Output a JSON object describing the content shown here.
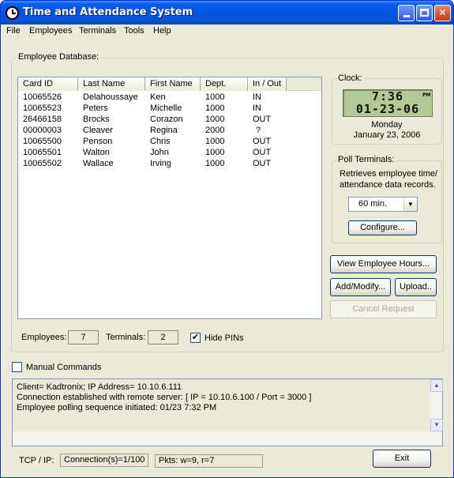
{
  "window": {
    "title": "Time and Attendance System"
  },
  "menu": [
    "File",
    "Employees",
    "Terminals",
    "Tools",
    "Help"
  ],
  "employee_db": {
    "group_label": "Employee Database:",
    "columns": [
      "Card ID",
      "Last Name",
      "First Name",
      "Dept.",
      "In / Out"
    ],
    "rows": [
      [
        "10065526",
        "Delahoussaye",
        "Ken",
        "1000",
        "IN"
      ],
      [
        "10065523",
        "Peters",
        "Michelle",
        "1000",
        "IN"
      ],
      [
        "26466158",
        "Brocks",
        "Corazon",
        "1000",
        "OUT"
      ],
      [
        "00000003",
        "Cleaver",
        "Regina",
        "2000",
        "?"
      ],
      [
        "10065500",
        "Penson",
        "Chris",
        "1000",
        "OUT"
      ],
      [
        "10065501",
        "Walton",
        "John",
        "1000",
        "OUT"
      ],
      [
        "10065502",
        "Wallace",
        "Irving",
        "1000",
        "OUT"
      ]
    ],
    "employees_label": "Employees:",
    "employees_count": "7",
    "terminals_label": "Terminals:",
    "terminals_count": "2",
    "hide_pins_label": "Hide PINs",
    "hide_pins_checked": true
  },
  "clock": {
    "group_label": "Clock:",
    "time": "7:36",
    "ampm": "PM",
    "date": "01-23-06",
    "weekday": "Monday",
    "long_date": "January 23, 2006"
  },
  "poll": {
    "group_label": "Poll Terminals:",
    "description_line1": "Retrieves employee time/",
    "description_line2": "attendance data records.",
    "interval": "60 min.",
    "configure_label": "Configure..."
  },
  "actions": {
    "view_hours": "View Employee Hours...",
    "add_modify": "Add/Modify...",
    "upload": "Upload..",
    "cancel_request": "Cancel  Request"
  },
  "manual_commands": {
    "label": "Manual Commands",
    "checked": false
  },
  "log": {
    "lines": [
      "Client= Kadtronix;  IP Address= 10.10.6.111",
      "Connection established with remote server:  [ IP = 10.10.6.100 / Port = 3000 ]",
      "Employee polling sequence initiated:  01/23  7:32 PM"
    ]
  },
  "status": {
    "tcp_label": "TCP / IP:",
    "connections": "Connection(s)=1/100",
    "packets": "Pkts: w=9, r=7",
    "exit_label": "Exit"
  }
}
